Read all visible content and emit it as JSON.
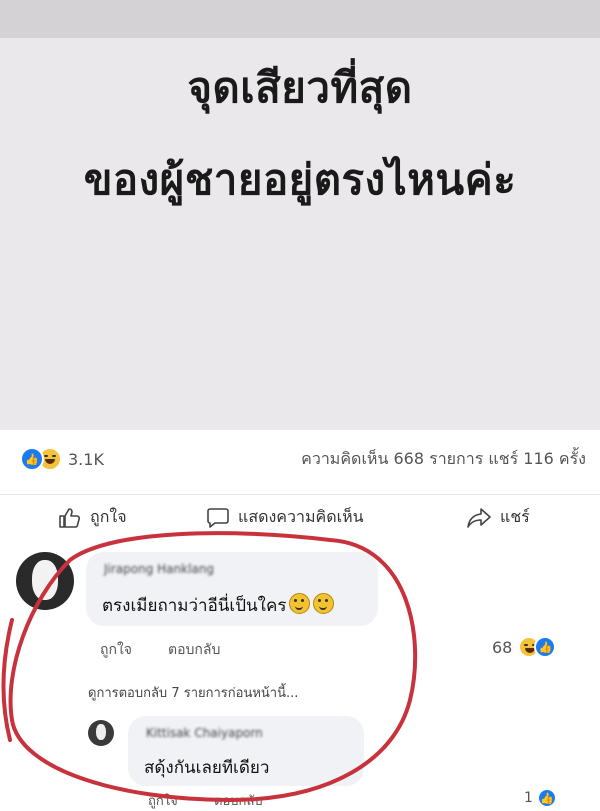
{
  "post": {
    "line1": "จุดเสียวที่สุด",
    "line2": "ของผู้ชายอยู่ตรงไหนค่ะ"
  },
  "stats": {
    "reaction_count": "3.1K",
    "comments_shares": "ความคิดเห็น 668 รายการ  แชร์ 116 ครั้ง"
  },
  "actions": {
    "like": "ถูกใจ",
    "comment": "แสดงความคิดเห็น",
    "share": "แชร์"
  },
  "comment1": {
    "author": "Jirapong Hanklang",
    "text": "ตรงเมียถามว่าอีนี่เป็นใคร",
    "like_label": "ถูกใจ",
    "reply_label": "ตอบกลับ",
    "reaction_count": "68",
    "view_previous": "ดูการตอบกลับ 7 รายการก่อนหน้านี้..."
  },
  "comment2": {
    "author": "Kittisak Chaiyaporn",
    "text": "สดุ้งกันเลยทีเดียว",
    "like_label": "ถูกใจ",
    "reply_label": "ตอบกลับ",
    "reaction_count": "1"
  },
  "colors": {
    "like_blue": "#1b7cf2",
    "haha_yellow": "#f5c33b",
    "annotation_red": "#c8323c",
    "post_background": "#eae8ea"
  }
}
